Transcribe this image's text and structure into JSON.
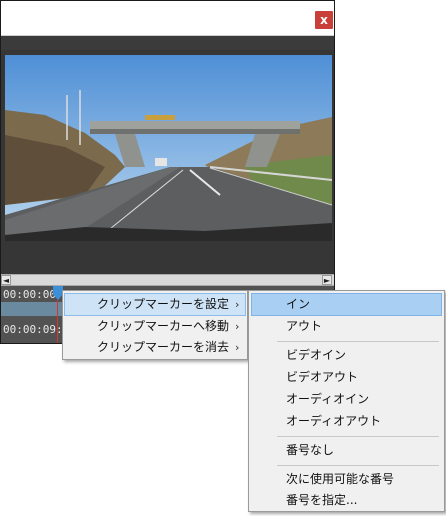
{
  "window": {
    "close_glyph": "x",
    "timecode_top": "00:00:00",
    "timecode_bottom": "00:00:09:00",
    "scroll_left_glyph": "◄",
    "scroll_right_glyph": "►"
  },
  "context_menu": {
    "items": [
      {
        "label": "クリップマーカーを設定",
        "arrow": "›"
      },
      {
        "label": "クリップマーカーへ移動",
        "arrow": "›"
      },
      {
        "label": "クリップマーカーを消去",
        "arrow": "›"
      }
    ]
  },
  "submenu": {
    "items": [
      {
        "label": "イン"
      },
      {
        "label": "アウト"
      },
      {
        "label": "ビデオイン"
      },
      {
        "label": "ビデオアウト"
      },
      {
        "label": "オーディオイン"
      },
      {
        "label": "オーディオアウト"
      },
      {
        "label": "番号なし"
      },
      {
        "label": "次に使用可能な番号"
      },
      {
        "label": "番号を指定..."
      }
    ]
  },
  "colors": {
    "highlight": "#a9cff2",
    "close_button": "#c9403a"
  }
}
